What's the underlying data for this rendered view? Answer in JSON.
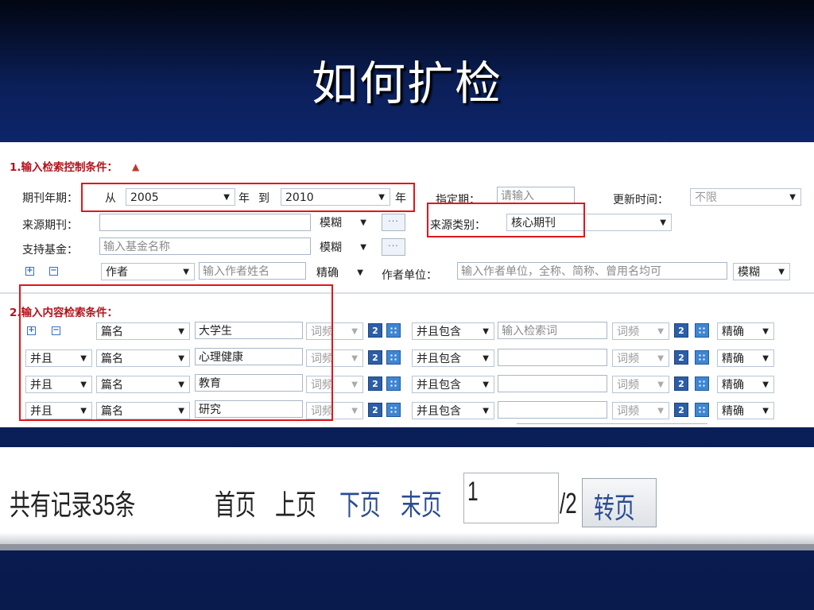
{
  "slide": {
    "title": "如何扩检"
  },
  "control": {
    "section_title": "1.输入检索控制条件：",
    "year_label": "期刊年期：",
    "from_text": "从",
    "year_from": "2005",
    "year_unit_1": "年",
    "to_text": "到",
    "year_to": "2010",
    "year_unit_2": "年",
    "issue_label": "指定期：",
    "issue_placeholder": "请输入",
    "update_label": "更新时间：",
    "update_value": "不限",
    "source_journal_label": "来源期刊：",
    "source_journal_value": "",
    "source_journal_mode": "模糊",
    "source_type_label": "来源类别：",
    "source_type_value": "核心期刊",
    "fund_label": "支持基金：",
    "fund_placeholder": "输入基金名称",
    "fund_mode": "模糊",
    "author_field": "作者",
    "author_placeholder": "输入作者姓名",
    "author_mode": "精确",
    "unit_label": "作者单位：",
    "unit_placeholder": "输入作者单位，全称、简称、曾用名均可",
    "unit_mode": "模糊",
    "dots": "···"
  },
  "content": {
    "section_title": "2.输入内容检索条件：",
    "freq_label": "词频",
    "relation_label": "并且包含",
    "term_placeholder": "输入检索词",
    "match_mode": "精确",
    "rows": [
      {
        "logic": "",
        "field": "篇名",
        "term": "大学生"
      },
      {
        "logic": "并且",
        "field": "篇名",
        "term": "心理健康"
      },
      {
        "logic": "并且",
        "field": "篇名",
        "term": "教育"
      },
      {
        "logic": "并且",
        "field": "篇名",
        "term": "研究"
      }
    ]
  },
  "pager": {
    "total": "共有记录35条",
    "first": "首页",
    "prev": "上页",
    "next": "下页",
    "last": "末页",
    "page_input": "1",
    "page_total": "/2",
    "go": "转页"
  }
}
